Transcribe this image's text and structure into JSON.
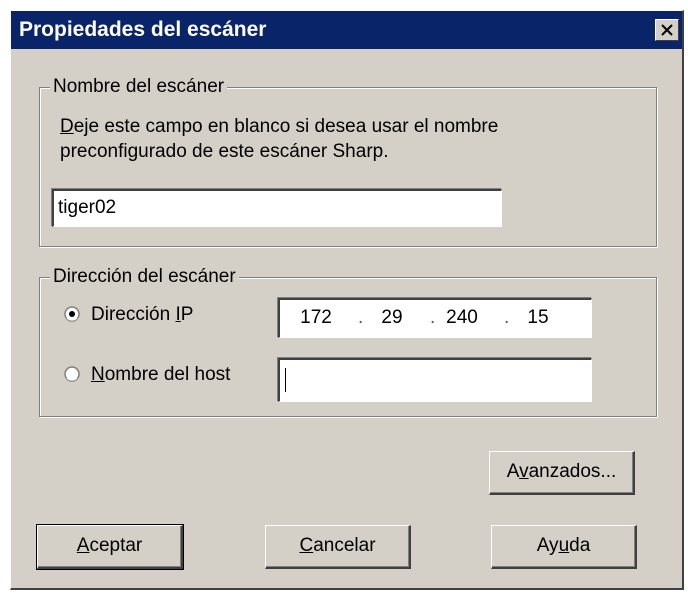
{
  "window": {
    "title": "Propiedades del escáner",
    "close_label": "×"
  },
  "name_group": {
    "legend": "Nombre del escáner",
    "desc_line1_mnemonic": "D",
    "desc_line1_rest": "eje este campo en blanco si desea usar el nombre",
    "desc_line2": "preconfigurado de este escáner Sharp.",
    "value": "tiger02"
  },
  "address_group": {
    "legend": "Dirección del escáner",
    "ip_option": {
      "prefix": "Dirección ",
      "mnemonic": "I",
      "suffix": "P",
      "selected": true
    },
    "ip": [
      "172",
      "29",
      "240",
      "15"
    ],
    "ip_separator": ".",
    "host_option": {
      "mnemonic": "N",
      "suffix": "ombre del host",
      "selected": false
    },
    "host_value": ""
  },
  "buttons": {
    "advanced": {
      "prefix": "A",
      "mnemonic": "v",
      "suffix": "anzados..."
    },
    "ok": {
      "mnemonic": "A",
      "suffix": "ceptar"
    },
    "cancel": {
      "mnemonic": "C",
      "suffix": "ancelar"
    },
    "help": {
      "prefix": "Ay",
      "mnemonic": "u",
      "suffix": "da"
    }
  }
}
